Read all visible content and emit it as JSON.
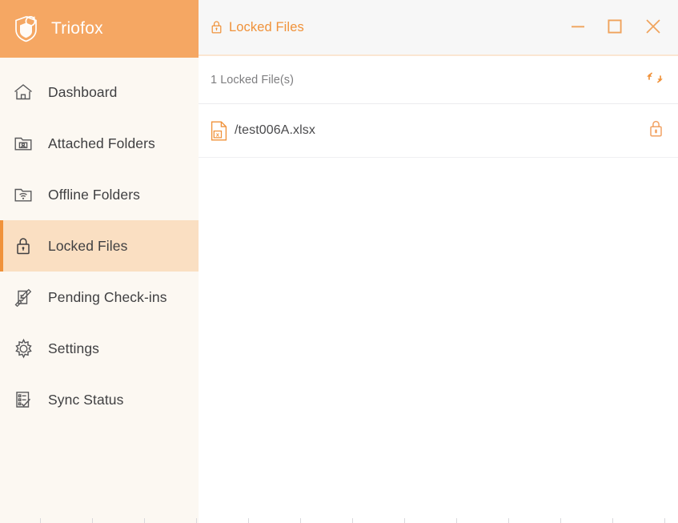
{
  "app": {
    "brand_name": "Triofox",
    "brand_logo_icon": "shield-fox-logo-icon"
  },
  "sidebar": {
    "items": [
      {
        "label": "Dashboard",
        "icon": "home-icon",
        "active": false
      },
      {
        "label": "Attached Folders",
        "icon": "folder-attached-icon",
        "active": false
      },
      {
        "label": "Offline Folders",
        "icon": "folder-offline-icon",
        "active": false
      },
      {
        "label": "Locked Files",
        "icon": "lock-icon",
        "active": true
      },
      {
        "label": "Pending Check-ins",
        "icon": "document-pen-icon",
        "active": false
      },
      {
        "label": "Settings",
        "icon": "gear-icon",
        "active": false
      },
      {
        "label": "Sync Status",
        "icon": "checklist-icon",
        "active": false
      }
    ]
  },
  "titlebar": {
    "title": "Locked Files",
    "title_icon": "lock-icon",
    "window_controls": [
      {
        "name": "minimize-button",
        "icon": "minimize-icon"
      },
      {
        "name": "maximize-button",
        "icon": "maximize-icon"
      },
      {
        "name": "close-button",
        "icon": "close-icon"
      }
    ]
  },
  "toolbar": {
    "count_text": "1 Locked File(s)",
    "refresh_icon": "refresh-sync-icon"
  },
  "files": [
    {
      "name": "/test006A.xlsx",
      "type_icon": "excel-file-icon",
      "status_icon": "lock-closed-icon"
    }
  ],
  "colors": {
    "brand_orange": "#f5a763",
    "accent_orange": "#f0923a",
    "sidebar_bg": "#fcf8f2",
    "active_item_bg": "#fadfc2",
    "titlebar_bg": "#f7f7f7",
    "content_bg": "#ffffff",
    "text_primary": "#3f3f41",
    "text_muted": "#7e7e80"
  }
}
